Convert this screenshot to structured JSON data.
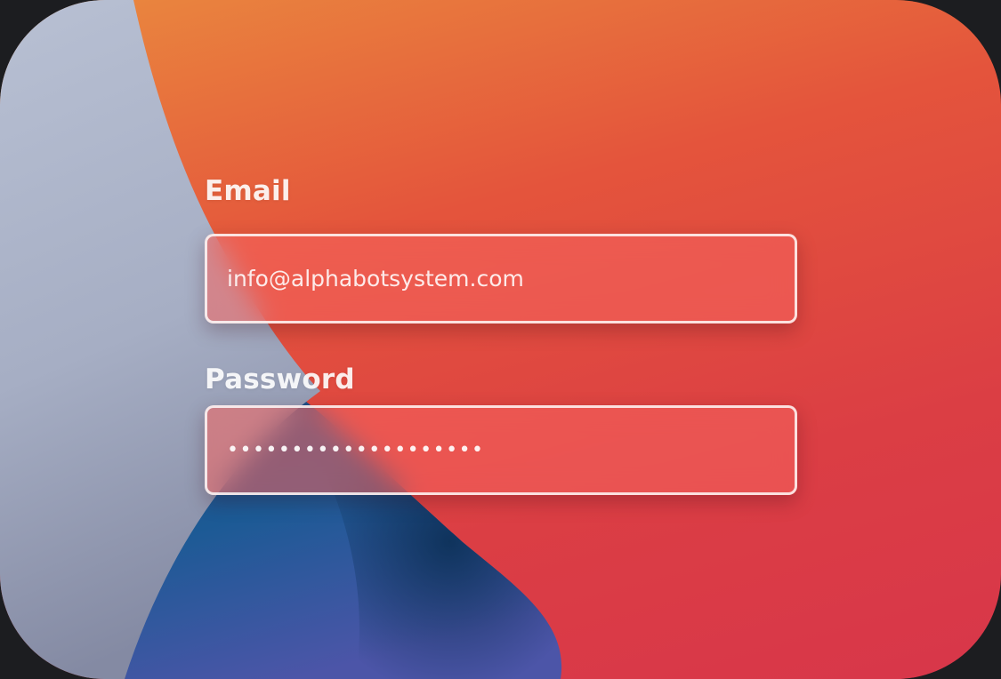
{
  "login": {
    "email": {
      "label": "Email",
      "value": "info@alphabotsystem.com"
    },
    "password": {
      "label": "Password",
      "masked_value": "••••••••••••••••••••"
    }
  },
  "colors": {
    "wallpaper_orange": "#ea8a3e",
    "wallpaper_red": "#db3e44",
    "wallpaper_grey": "#b7bfd2",
    "wallpaper_blue": "#1f5a91",
    "field_fill": "#f5645f",
    "frame_background": "#1c1d20"
  }
}
